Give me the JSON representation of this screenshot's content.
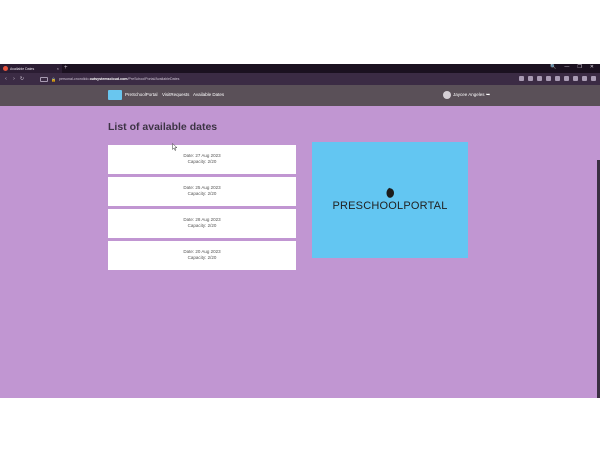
{
  "browser": {
    "tab_title": "Available Dates",
    "tab_close": "×",
    "new_tab": "+",
    "window_controls": [
      "🔍",
      "—",
      "❐",
      "✕"
    ],
    "nav": {
      "back": "‹",
      "forward": "›",
      "reload": "↻"
    },
    "lock": "🔒",
    "url_prefix": "personal-cnondido.",
    "url_domain": "outsystemscloud.com",
    "url_path": "/PreSchoolPortal/AvailableDates"
  },
  "app": {
    "brand": "PreSchoolPortal",
    "nav_links": [
      "VisitRequests",
      "Available Dates"
    ],
    "user_name": "Jaycee Angeles",
    "logout_icon": "➥"
  },
  "page": {
    "title": "List of available dates",
    "dates": [
      {
        "date": "Date: 27 Aug 2023",
        "capacity": "Capacity: 2/20"
      },
      {
        "date": "Date: 25 Aug 2023",
        "capacity": "Capacity: 2/20"
      },
      {
        "date": "Date: 28 Aug 2023",
        "capacity": "Capacity: 2/20"
      },
      {
        "date": "Date: 20 Aug 2023",
        "capacity": "Capacity: 2/20"
      }
    ],
    "promo_text": "PRESCHOOLPORTAL"
  },
  "colors": {
    "page_bg": "#c196d2",
    "navbar": "#5a5058",
    "promo_bg": "#63c6f2",
    "logo": "#69c6ef"
  }
}
